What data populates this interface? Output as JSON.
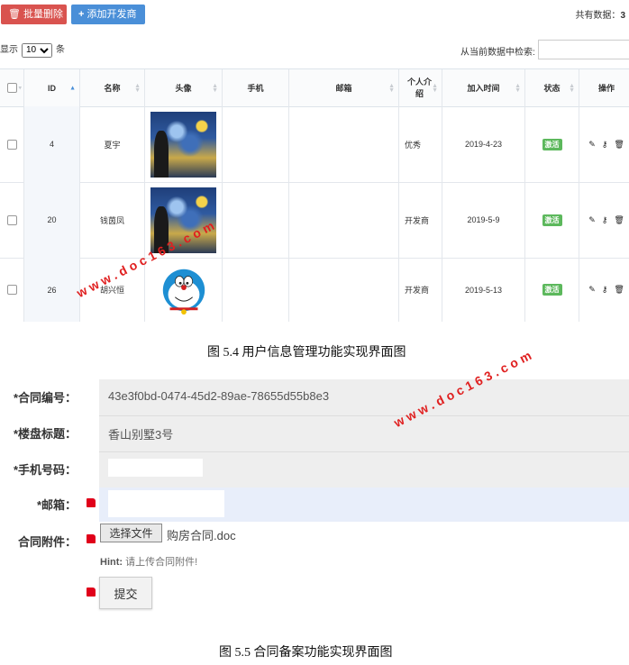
{
  "toolbar": {
    "batch_delete_label": "批量删除",
    "batch_delete_icon": "trash-icon",
    "add_developer_label": "添加开发商",
    "add_developer_icon": "plus-icon",
    "total_label": "共有数据：",
    "total_value": "3"
  },
  "table_controls": {
    "show_prefix": "显示",
    "page_length": "10",
    "show_suffix": "条",
    "search_label": "从当前数据中检索:",
    "search_value": ""
  },
  "table": {
    "columns": [
      "ID",
      "名称",
      "头像",
      "手机",
      "邮箱",
      "个人介绍",
      "加入时间",
      "状态",
      "操作"
    ],
    "rows": [
      {
        "id": "4",
        "name": "夏宇",
        "avatar": "starry-night",
        "phone": "",
        "email": "",
        "intro": "优秀",
        "joined": "2019-4-23",
        "status": "激活"
      },
      {
        "id": "20",
        "name": "钱茵凤",
        "avatar": "starry-night",
        "phone": "",
        "email": "",
        "intro": "开发商",
        "joined": "2019-5-9",
        "status": "激活"
      },
      {
        "id": "26",
        "name": "胡兴恒",
        "avatar": "doraemon",
        "phone": "",
        "email": "",
        "intro": "开发商",
        "joined": "2019-5-13",
        "status": "激活"
      }
    ],
    "action_icons": [
      "edit-icon",
      "key-icon",
      "trash-icon"
    ],
    "status_color": "#5cb85c"
  },
  "caption_top": "图 5.4 用户信息管理功能实现界面图",
  "form": {
    "contract_no_label": "*合同编号：",
    "contract_no_value": "43e3f0bd-0474-45d2-89ae-78655d55b8e3",
    "title_label": "*楼盘标题：",
    "title_value": "香山别墅3号",
    "phone_label": "*手机号码：",
    "phone_value": "",
    "email_label": "*邮箱：",
    "email_value": "",
    "attachment_label": "合同附件：",
    "choose_file_label": "选择文件",
    "file_name": "购房合同.doc",
    "hint_prefix": "Hint:",
    "hint_text": " 请上传合同附件!",
    "submit_label": "提交"
  },
  "caption_bottom": "图 5.5  合同备案功能实现界面图",
  "watermark": "www.doc163.com",
  "colors": {
    "danger": "#d9534f",
    "primary": "#4a8fd8",
    "success": "#5cb85c",
    "watermark": "#e02020"
  }
}
